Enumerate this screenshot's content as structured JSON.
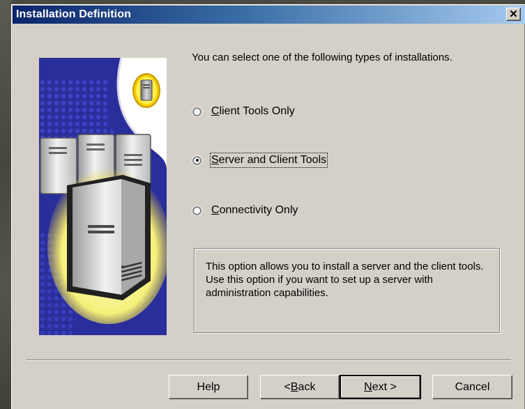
{
  "window": {
    "title": "Installation Definition",
    "close_glyph": "✕"
  },
  "intro": "You can select one of the following types of installations.",
  "options": [
    {
      "label": "Client Tools Only",
      "mnemonic": "C",
      "rest": "lient Tools Only",
      "selected": false
    },
    {
      "label": "Server and Client Tools",
      "mnemonic": "S",
      "rest": "erver and Client Tools",
      "selected": true
    },
    {
      "label": "Connectivity Only",
      "mnemonic": "C",
      "rest": "onnectivity Only",
      "selected": false
    }
  ],
  "description": "This option allows you to install a server and the client tools. Use this option if you want to set up a server with administration capabilities.",
  "buttons": {
    "help": "Help",
    "back": {
      "label": "< Back",
      "prefix": "< ",
      "mnemonic": "B",
      "rest": "ack"
    },
    "next": {
      "label": "Next >",
      "mnemonic": "N",
      "rest": "ext >"
    },
    "cancel": "Cancel"
  },
  "colors": {
    "titlebar_start": "#0a246a",
    "titlebar_end": "#a6caf0",
    "dialog_face": "#d4d0c8",
    "art_blue": "#2a2e9a",
    "art_glow": "#f5f07a"
  },
  "icons": [
    "close-icon",
    "server-illustration",
    "tower-server-icon"
  ]
}
